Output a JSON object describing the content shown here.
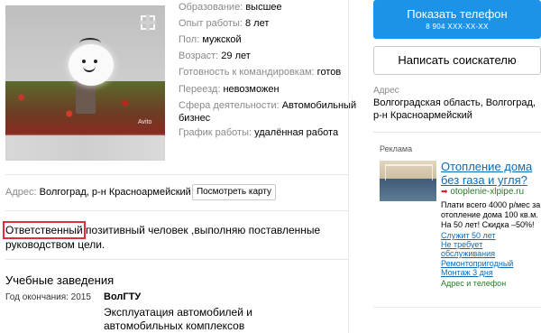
{
  "details": [
    {
      "label": "Образование:",
      "value": "высшее"
    },
    {
      "label": "Опыт работы:",
      "value": "8 лет"
    },
    {
      "label": "Пол:",
      "value": "мужской"
    },
    {
      "label": "Возраст:",
      "value": "29 лет"
    },
    {
      "label": "Готовность к командировкам:",
      "value": "готов"
    },
    {
      "label": "Переезд:",
      "value": "невозможен"
    },
    {
      "label": "Сфера деятельности:",
      "value": "Автомобильный"
    },
    {
      "label": "",
      "value": "бизнес"
    },
    {
      "label": "График работы:",
      "value": "удалённая работа"
    }
  ],
  "photo": {
    "watermark": "Avito",
    "expand_icon": "expand-icon"
  },
  "address": {
    "label": "Адрес:",
    "value": "Волгоград, р-н Красноармейский",
    "map_button": "Посмотреть карту"
  },
  "description": {
    "highlighted": "Ответственный",
    "rest": " позитивный человек ,выполняю поставленные руководством цели."
  },
  "education": {
    "title": "Учебные заведения",
    "year": "Год окончания: 2015",
    "institution": "ВолГТУ",
    "specialty": "Эксплуатация автомобилей и автомобильных комплексов"
  },
  "contact": {
    "show_phone": "Показать телефон",
    "phone_masked": "8 904 XXX-XX-XX",
    "write": "Написать соискателю"
  },
  "right_address": {
    "label": "Адрес",
    "value": "Волгоградская область, Волгоград, р-н Красноармейский"
  },
  "ad": {
    "label": "Реклама",
    "title": "Отопление дома без газа и угля?",
    "site": "otoplenie-xlpipe.ru",
    "text": "Плати всего 4000 р/мес за отопление дома 100 кв.м. На 50 лет! Скидка –50%!",
    "links": [
      "Служит 50 лет",
      "Не требует",
      "обслуживания",
      "Ремонтопригодный",
      "Монтаж 3 дня"
    ],
    "contact": "Адрес и телефон"
  },
  "colors": {
    "accent": "#1d93e8",
    "highlight_border": "#e32b3b",
    "link": "#0c6bb8",
    "green": "#2b7a2b"
  }
}
